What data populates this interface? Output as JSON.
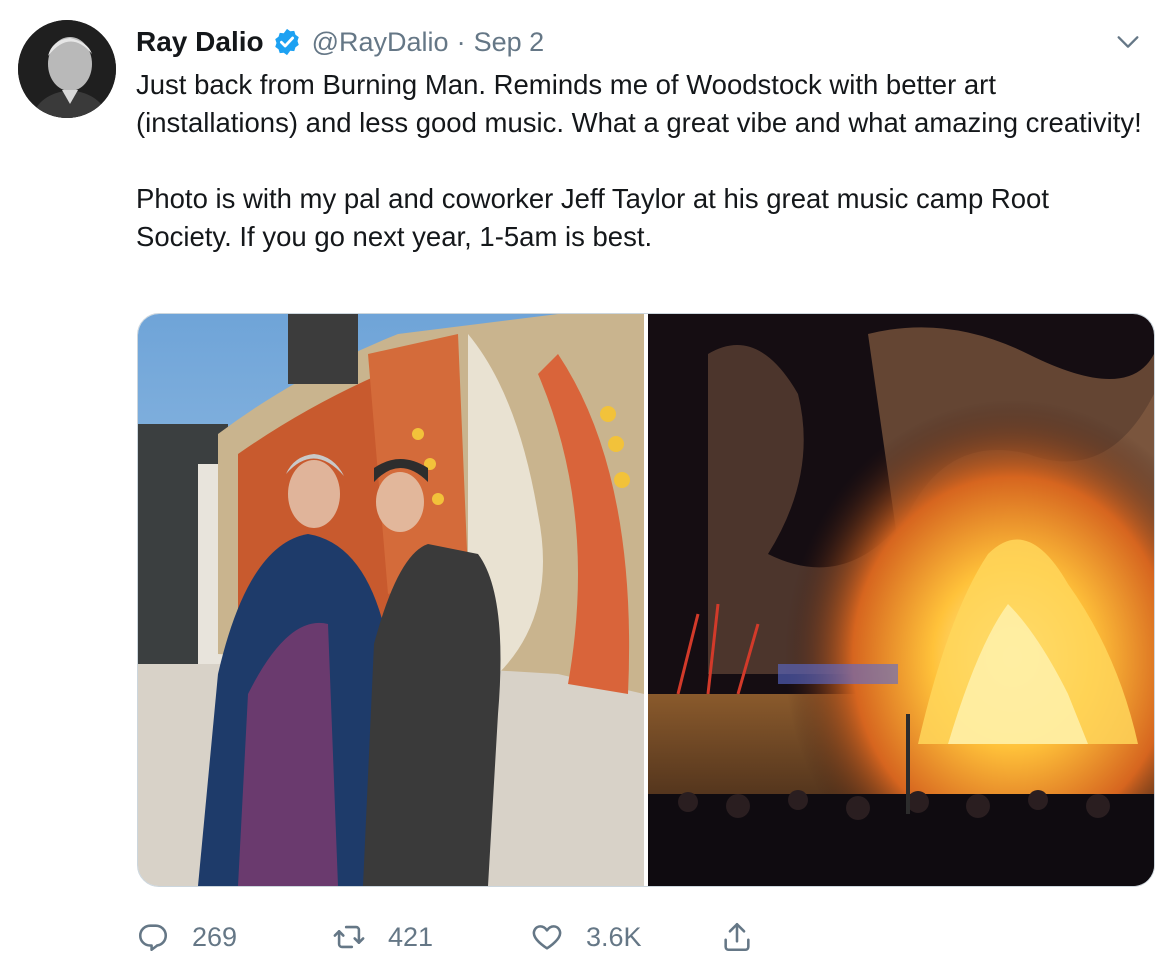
{
  "tweet": {
    "author_name": "Ray Dalio",
    "handle": "@RayDalio",
    "separator": "·",
    "date": "Sep 2",
    "text": "Just back from Burning Man. Reminds me of Woodstock with better art (installations) and less good music. What a great vibe and what amazing creativity!\n\nPhoto is with my pal and coworker Jeff Taylor at his great music camp Root Society. If you go next year, 1-5am is best."
  },
  "stats": {
    "replies": "269",
    "retweets": "421",
    "likes": "3.6K"
  },
  "icons": {
    "verified": "verified-badge-icon",
    "caret": "chevron-down-icon",
    "reply": "reply-icon",
    "retweet": "retweet-icon",
    "like": "heart-icon",
    "share": "share-icon"
  },
  "colors": {
    "text": "#14171a",
    "secondary": "#657786",
    "verified": "#1da1f2",
    "border": "#ccd6dd"
  }
}
